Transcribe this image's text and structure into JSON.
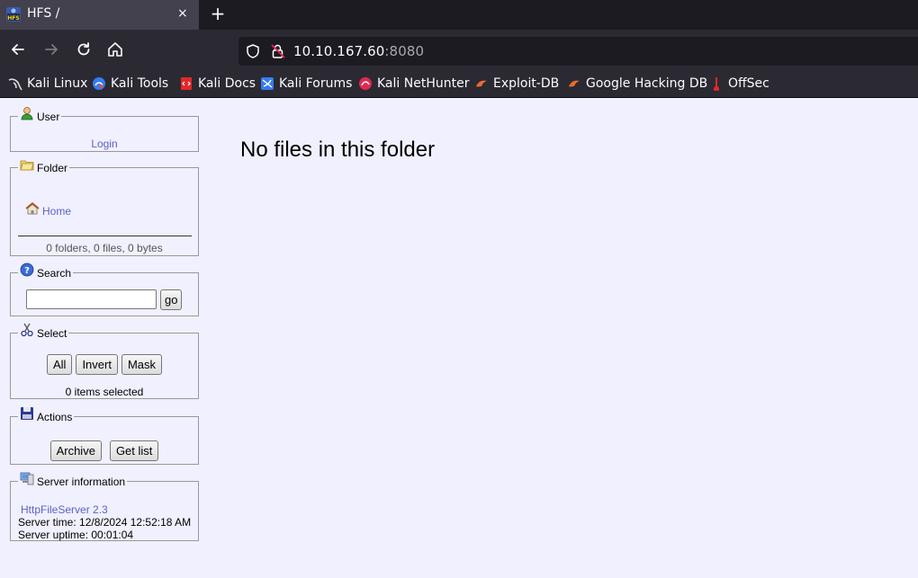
{
  "browser": {
    "tab_title": "HFS /",
    "tab_close": "×",
    "new_tab": "+",
    "url_host": "10.10.167.60",
    "url_port": ":8080"
  },
  "bookmarks": [
    {
      "label": "Kali Linux",
      "icon": "kali-linux-icon"
    },
    {
      "label": "Kali Tools",
      "icon": "kali-tools-icon"
    },
    {
      "label": "Kali Docs",
      "icon": "kali-docs-icon"
    },
    {
      "label": "Kali Forums",
      "icon": "kali-forums-icon"
    },
    {
      "label": "Kali NetHunter",
      "icon": "kali-nethunter-icon"
    },
    {
      "label": "Exploit-DB",
      "icon": "exploit-db-icon"
    },
    {
      "label": "Google Hacking DB",
      "icon": "ghdb-icon"
    },
    {
      "label": "OffSec",
      "icon": "offsec-icon"
    }
  ],
  "user_panel": {
    "legend": "User",
    "login": "Login"
  },
  "folder_panel": {
    "legend": "Folder",
    "home": "Home",
    "stats": "0 folders, 0 files, 0 bytes"
  },
  "search_panel": {
    "legend": "Search",
    "go": "go",
    "query": ""
  },
  "select_panel": {
    "legend": "Select",
    "all": "All",
    "invert": "Invert",
    "mask": "Mask",
    "status": "0 items selected"
  },
  "actions_panel": {
    "legend": "Actions",
    "archive": "Archive",
    "get_list": "Get list"
  },
  "server_panel": {
    "legend": "Server information",
    "version": "HttpFileServer 2.3",
    "time": "Server time: 12/8/2024 12:52:18 AM",
    "uptime": "Server uptime: 00:01:04"
  },
  "main": {
    "message": "No files in this folder"
  }
}
